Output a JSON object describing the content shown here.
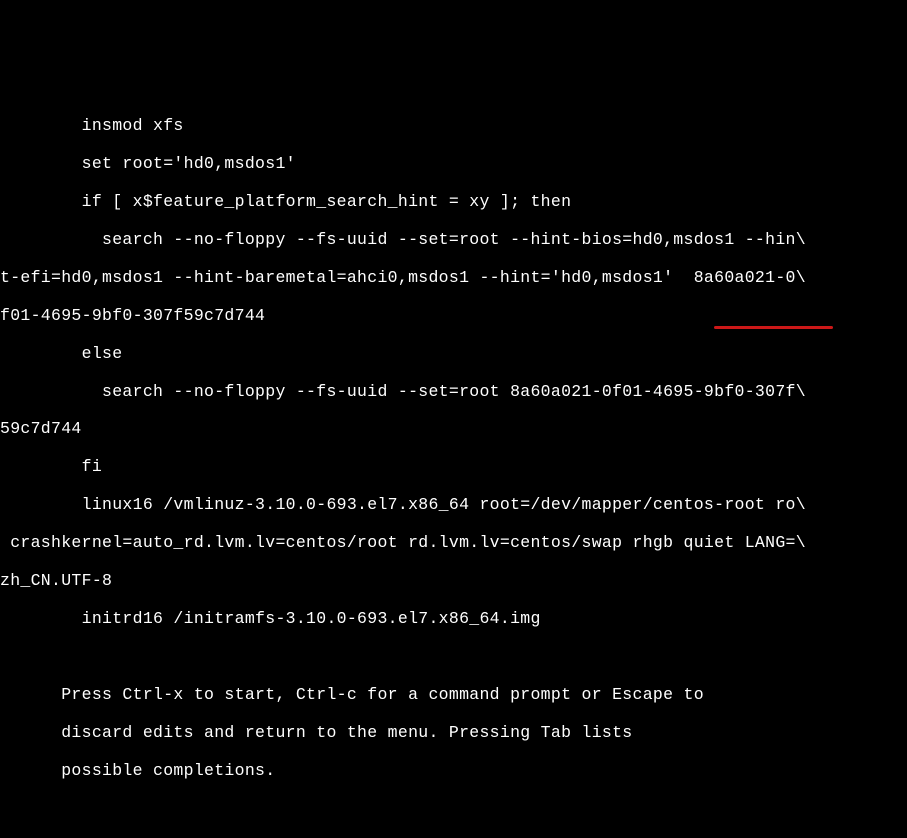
{
  "grub_editor": {
    "lines": [
      "        insmod xfs",
      "        set root='hd0,msdos1'",
      "        if [ x$feature_platform_search_hint = xy ]; then",
      "          search --no-floppy --fs-uuid --set=root --hint-bios=hd0,msdos1 --hin\\",
      "t-efi=hd0,msdos1 --hint-baremetal=ahci0,msdos1 --hint='hd0,msdos1'  8a60a021-0\\",
      "f01-4695-9bf0-307f59c7d744",
      "        else",
      "          search --no-floppy --fs-uuid --set=root 8a60a021-0f01-4695-9bf0-307f\\",
      "59c7d744",
      "        fi",
      "        linux16 /vmlinuz-3.10.0-693.el7.x86_64 root=/dev/mapper/centos-root ro\\",
      " crashkernel=auto_rd.lvm.lv=centos/root rd.lvm.lv=centos/swap rhgb quiet LANG=\\",
      "zh_CN.UTF-8",
      "        initrd16 /initramfs-3.10.0-693.el7.x86_64.img",
      "",
      "",
      "      Press Ctrl-x to start, Ctrl-c for a command prompt or Escape to",
      "      discard edits and return to the menu. Pressing Tab lists",
      "      possible completions."
    ],
    "highlighted_text": "rhgb quiet",
    "annotation": {
      "description": "red-underline-marker",
      "target_line_index": 11,
      "target_substring": "rhgb quiet"
    }
  }
}
